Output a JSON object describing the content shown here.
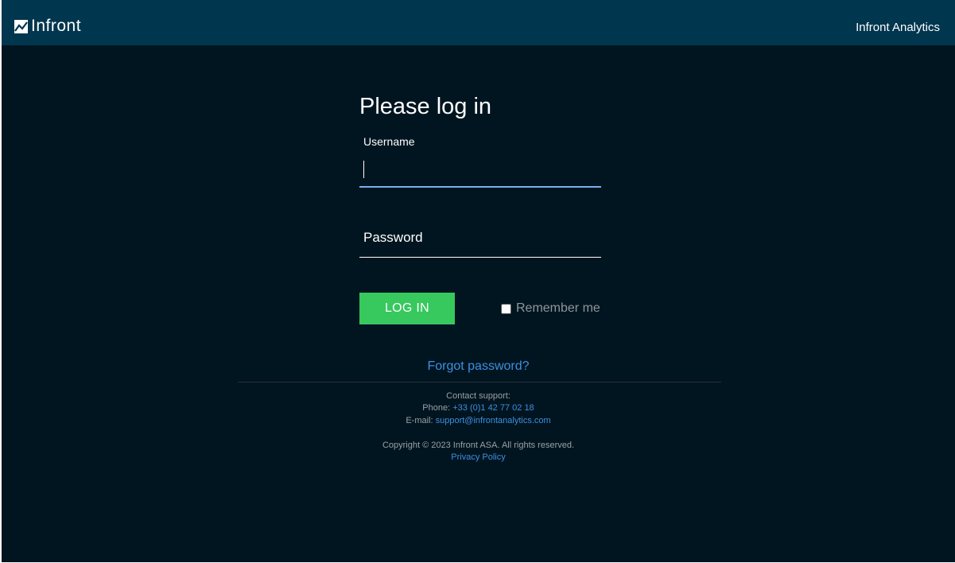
{
  "header": {
    "logo_text": "Infront",
    "app_name": "Infront Analytics"
  },
  "login": {
    "title": "Please log in",
    "username_label": "Username",
    "username_value": "",
    "password_label": "Password",
    "password_value": "",
    "login_button": "LOG IN",
    "remember_me": "Remember me",
    "remember_checked": false,
    "forgot_password": "Forgot password?"
  },
  "footer": {
    "contact_heading": "Contact support:",
    "phone_label": "Phone:",
    "phone": "+33 (0)1 42 77 02 18",
    "email_label": "E-mail:",
    "email": "support@infrontanalytics.com",
    "copyright": "Copyright © 2023 Infront ASA. All rights reserved.",
    "privacy": "Privacy Policy"
  },
  "colors": {
    "header_bg": "#00364e",
    "page_bg": "#011520",
    "accent_green": "#37c85e",
    "link_blue": "#3d8fe0",
    "focus_underline": "#7ab0ec"
  },
  "icons": {
    "logo": "chart-trend-icon"
  }
}
